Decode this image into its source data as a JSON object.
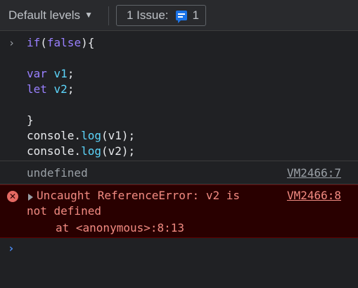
{
  "toolbar": {
    "levels_label": "Default levels",
    "caret": "▼",
    "issues_label": "1 Issue:",
    "issues_count": "1"
  },
  "input": {
    "prompt": "›",
    "lines": [
      "if(false){",
      "",
      "var v1;",
      "let v2;",
      "",
      "}",
      "console.log(v1);",
      "console.log(v2);"
    ]
  },
  "result": {
    "text": "undefined",
    "source": "VM2466:7"
  },
  "error": {
    "icon": "✕",
    "line1": "Uncaught ReferenceError: v2 is",
    "line2": "not defined",
    "line3": "at <anonymous>:8:13",
    "source": "VM2466:8"
  },
  "new_prompt": "›",
  "colors": {
    "background": "#202124",
    "error_bg": "#290000",
    "error_text": "#f28b82",
    "keyword": "#9980ff",
    "variable": "#5cd5fb",
    "prompt_blue": "#4c8df6",
    "issue_blue": "#1a73e8"
  }
}
